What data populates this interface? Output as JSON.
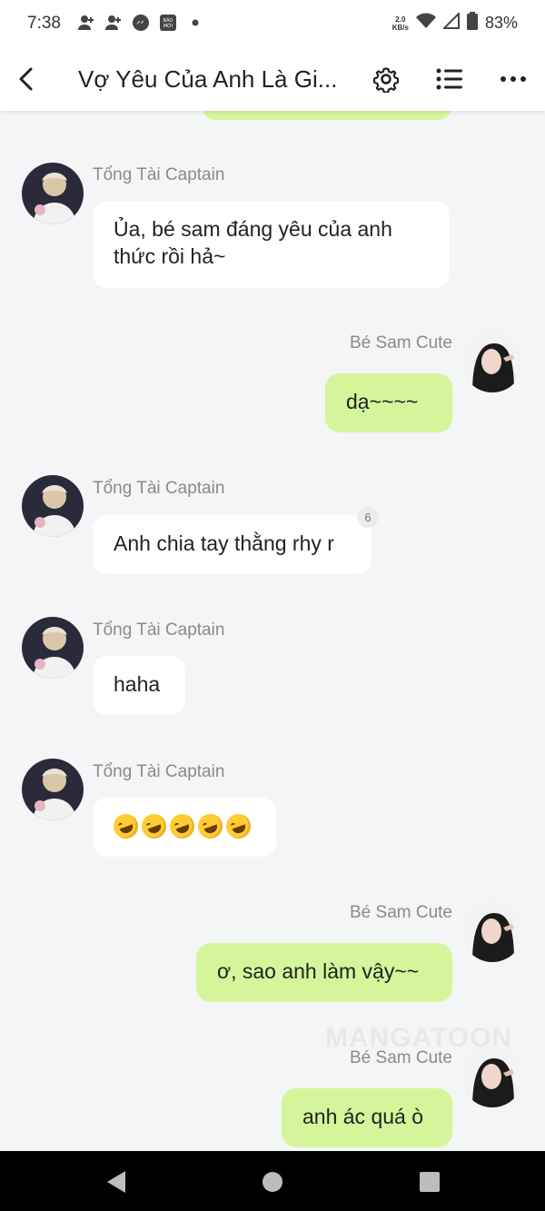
{
  "status_bar": {
    "time": "7:38",
    "net_speed_value": "2.0",
    "net_speed_unit": "KB/s",
    "battery": "83%",
    "icons_left": [
      "user-add-icon",
      "user-add-icon",
      "messenger-icon",
      "baomoi-icon",
      "dot-icon"
    ],
    "baomoi_text": "BÁO MỚI"
  },
  "header": {
    "title": "Vợ Yêu Của Anh Là Gi...",
    "icons": [
      "back-icon",
      "gear-icon",
      "list-icon",
      "more-icon"
    ]
  },
  "messages": [
    {
      "sender": "Tổng Tài Captain",
      "text": "Ủa, bé sam đáng yêu của anh thức rồi hả~",
      "side": "in"
    },
    {
      "sender": "Bé Sam Cute",
      "text": "dạ~~~~",
      "side": "out"
    },
    {
      "sender": "Tổng Tài Captain",
      "text": "Anh chia tay thằng rhy r",
      "side": "in",
      "badge": "6"
    },
    {
      "sender": "Tổng Tài Captain",
      "text": "haha",
      "side": "in"
    },
    {
      "sender": "Tổng Tài Captain",
      "text": "",
      "side": "in",
      "emoji": "rolling-on-floor-laughing",
      "emoji_count": 5
    },
    {
      "sender": "Bé Sam Cute",
      "text": "ơ, sao anh làm vậy~~",
      "side": "out"
    },
    {
      "sender": "Bé Sam Cute",
      "text": "anh ác quá ò",
      "side": "out"
    }
  ],
  "watermark": "MANGATOON",
  "colors": {
    "incoming_bubble": "#ffffff",
    "outgoing_bubble": "#d4f59a",
    "background": "#f4f5f7",
    "sender_name": "#8a8a8a"
  }
}
